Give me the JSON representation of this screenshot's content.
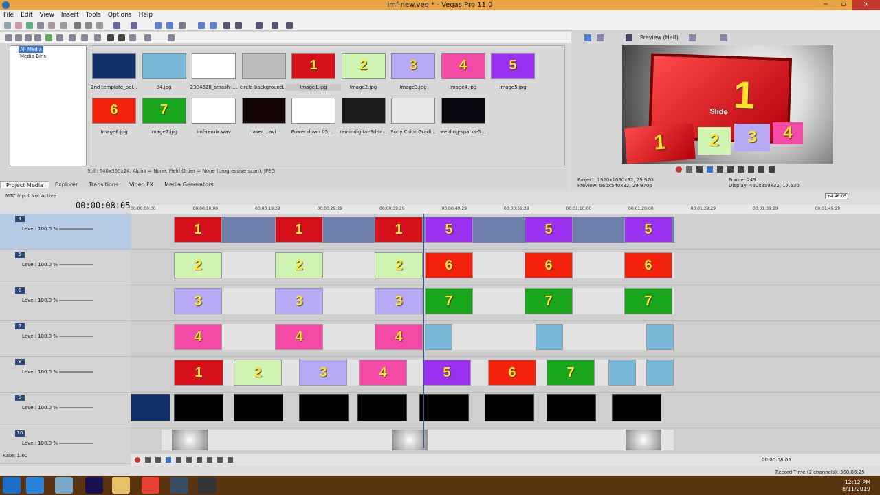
{
  "window": {
    "title": "imf-new.veg * - Vegas Pro 11.0",
    "min": "−",
    "max": "▫",
    "close": "×"
  },
  "menu": [
    "File",
    "Edit",
    "View",
    "Insert",
    "Tools",
    "Options",
    "Help"
  ],
  "tree": {
    "all_media": "All Media",
    "media_bins": "Media Bins"
  },
  "media": [
    {
      "name": "2nd template_pol...",
      "color": "#10306a",
      "num": ""
    },
    {
      "name": "04.jpg",
      "color": "#79b7d8",
      "num": ""
    },
    {
      "name": "2304628_smash-i...",
      "color": "#ffffff",
      "num": ""
    },
    {
      "name": "circle-background...",
      "color": "#bcbcbc",
      "num": ""
    },
    {
      "name": "Image1.jpg",
      "color": "#d6101a",
      "num": "1"
    },
    {
      "name": "Image2.jpg",
      "color": "#cff3b0",
      "num": "2"
    },
    {
      "name": "Image3.jpg",
      "color": "#b7a9f5",
      "num": "3"
    },
    {
      "name": "Image4.jpg",
      "color": "#f34aa5",
      "num": "4"
    },
    {
      "name": "Image5.jpg",
      "color": "#9b31f0",
      "num": "5"
    },
    {
      "name": "Image6.jpg",
      "color": "#f2220d",
      "num": "6"
    },
    {
      "name": "Image7.jpg",
      "color": "#16a51b",
      "num": "7"
    },
    {
      "name": "imf-remix.wav",
      "color": "#ffffff",
      "num": ""
    },
    {
      "name": "laser....avi",
      "color": "#120404",
      "num": ""
    },
    {
      "name": "Power down 05, ...",
      "color": "#ffffff",
      "num": ""
    },
    {
      "name": "ramindigital-3d-lo...",
      "color": "#1b1b1b",
      "num": ""
    },
    {
      "name": "Sony Color Gradi...",
      "color": "#e9e9e9",
      "num": ""
    },
    {
      "name": "welding-sparks-5...",
      "color": "#06070f",
      "num": ""
    }
  ],
  "status": "Still: 640x360x24, Alpha = None, Field Order = None (progressive scan), JPEG",
  "tabs": [
    "Project Media",
    "Explorer",
    "Transitions",
    "Video FX",
    "Media Generators"
  ],
  "preview": {
    "mode": "Preview (Half)",
    "slide": "Slide",
    "big_num": "1",
    "project": "Project:   1920x1080x32, 29.970i",
    "preview": "Preview:   960x540x32, 29.970p",
    "frame": "Frame:   243",
    "display": "Display:   460x259x32, 17.630"
  },
  "timeline": {
    "mtc": "MTC Input Not Active",
    "cursor": "00:00:08:05",
    "ruler": [
      "00:00:00:00",
      "00:00:10:00",
      "00:00:19:29",
      "00:00:29:29",
      "00:00:39:29",
      "00:00:49:29",
      "00:00:59:28",
      "00:01:10:00",
      "00:01:20:00",
      "00:01:29:29",
      "00:01:39:29",
      "00:01:49:29"
    ],
    "marker": "+4:46:03",
    "level": "Level: 100.0 %",
    "tracks": [
      "4",
      "5",
      "6",
      "7",
      "8",
      "9",
      "10"
    ],
    "rate": "Rate: 1.00",
    "timecode": "00:00:08:05",
    "record": "Record Time (2 channels): 360:06:25"
  },
  "clock": {
    "time": "12:12 PM",
    "date": "8/11/2019"
  }
}
